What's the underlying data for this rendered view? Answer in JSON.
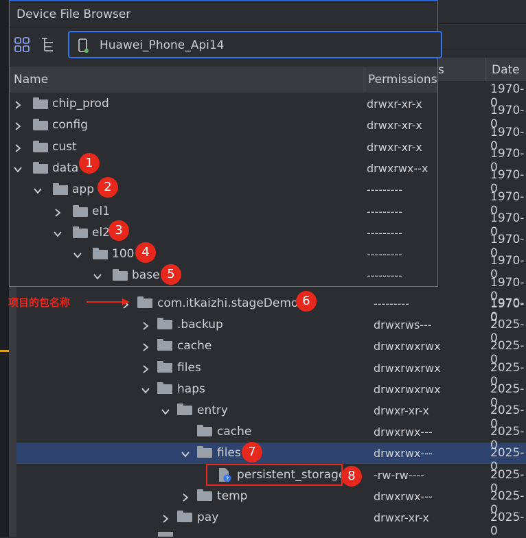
{
  "panel": {
    "title": "Device File Browser",
    "device": "Huawei_Phone_Api14",
    "col_name": "Name",
    "col_permissions": "Permissions",
    "rows": [
      {
        "name": "chip_prod",
        "perm": "drwxr-xr-x"
      },
      {
        "name": "config",
        "perm": "drwxr-xr-x"
      },
      {
        "name": "cust",
        "perm": "drwxr-xr-x"
      },
      {
        "name": "data",
        "perm": "drwxrwx--x"
      },
      {
        "name": "app",
        "perm": "---------"
      },
      {
        "name": "el1",
        "perm": "---------"
      },
      {
        "name": "el2",
        "perm": "---------"
      },
      {
        "name": "100",
        "perm": "---------"
      },
      {
        "name": "base",
        "perm": "---------"
      }
    ]
  },
  "background": {
    "col_date": "Date",
    "col_partial": "s",
    "dates_top": [
      "1970-0",
      "1970-0",
      "1970-0",
      "1970-0",
      "1970-0",
      "1970-0",
      "1970-0",
      "1970-0",
      "1970-0",
      "1970-0",
      "1970-0"
    ],
    "rows": [
      {
        "name": "com.itkaizhi.stageDemo",
        "perm": "---------",
        "date": "1970-0"
      },
      {
        "name": ".backup",
        "perm": "drwxrws---",
        "date": "2025-0"
      },
      {
        "name": "cache",
        "perm": "drwxrwxrwx",
        "date": "2025-0"
      },
      {
        "name": "files",
        "perm": "drwxrwxrwx",
        "date": "2025-0"
      },
      {
        "name": "haps",
        "perm": "drwxrwxrwx",
        "date": "2025-0"
      },
      {
        "name": "entry",
        "perm": "drwxr-xr-x",
        "date": "2025-0"
      },
      {
        "name": "cache",
        "perm": "drwxrwx---",
        "date": "2025-0"
      },
      {
        "name": "files",
        "perm": "drwxrwx---",
        "date": "2025-0"
      },
      {
        "name": "persistent_storage",
        "perm": "-rw-rw----",
        "date": "2025-0"
      },
      {
        "name": "temp",
        "perm": "drwxrwx---",
        "date": "2025-0"
      },
      {
        "name": "pay",
        "perm": "drwxr-xr-x",
        "date": "2025-0"
      }
    ]
  },
  "annotation": {
    "label": "项目的包名称",
    "badges": [
      "1",
      "2",
      "3",
      "4",
      "5",
      "6",
      "7",
      "8"
    ]
  },
  "colors": {
    "accent": "#3574f0",
    "selection": "#2e436e",
    "badge": "#e8281d",
    "annotation_text": "#e8281d"
  }
}
